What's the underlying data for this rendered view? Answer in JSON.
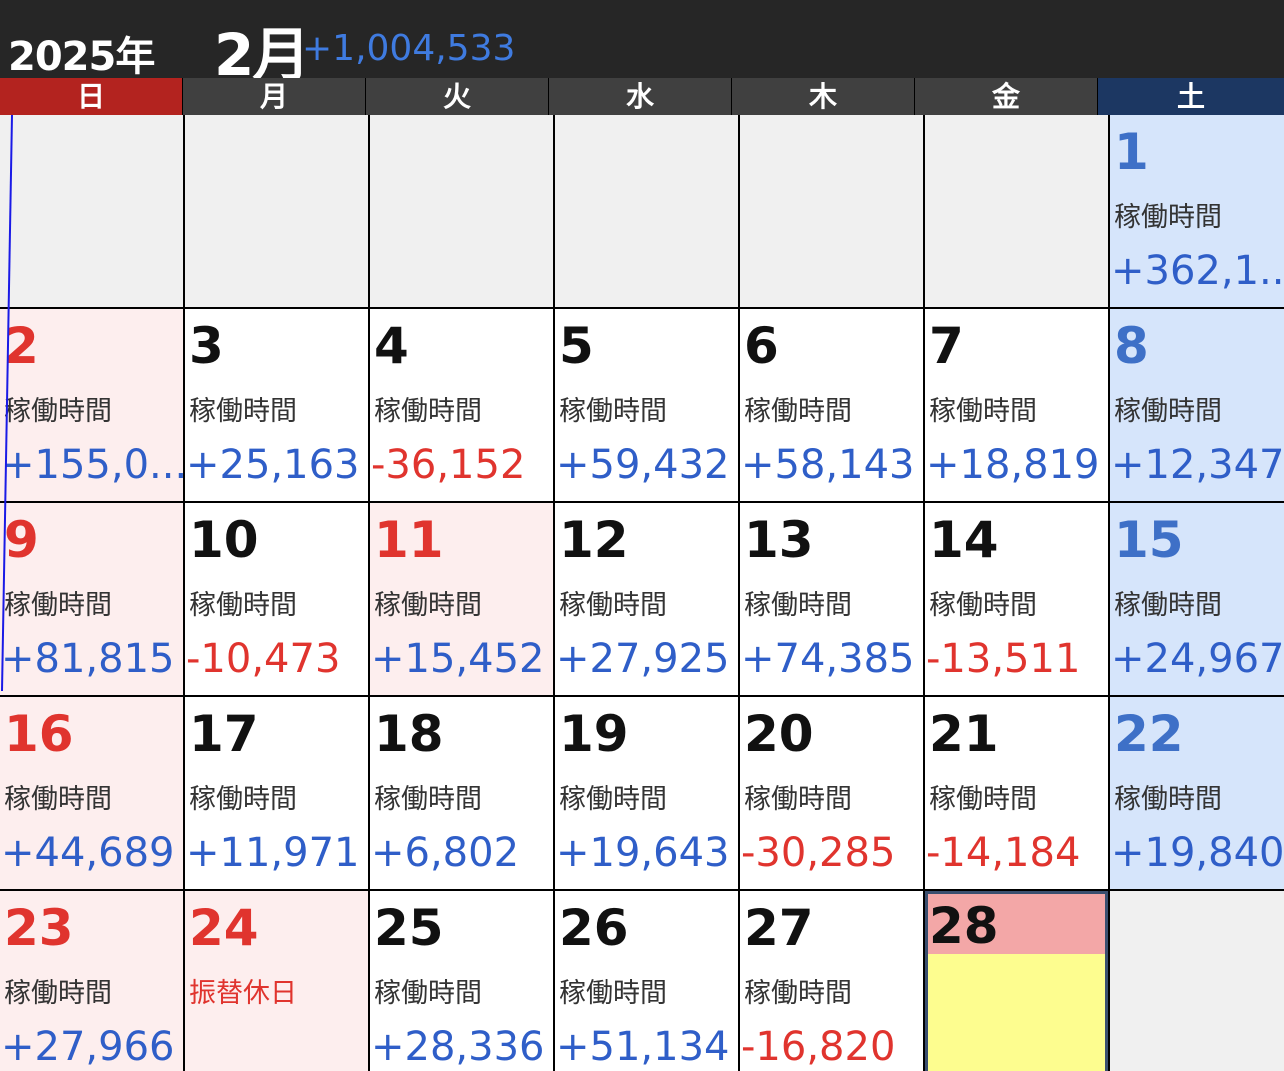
{
  "header": {
    "year": "2025年",
    "month": "2月",
    "total": "+1,004,533"
  },
  "weekdays": [
    "日",
    "月",
    "火",
    "水",
    "木",
    "金",
    "土"
  ],
  "colors": {
    "positive": "#2f5ec8",
    "negative": "#e0342e",
    "sunday": "#b3231f",
    "saturday": "#1c3762"
  },
  "cells": [
    {
      "type": "empty"
    },
    {
      "type": "empty"
    },
    {
      "type": "empty"
    },
    {
      "type": "empty"
    },
    {
      "type": "empty"
    },
    {
      "type": "empty"
    },
    {
      "type": "sat",
      "day": "1",
      "label": "稼働時間",
      "value": "+362,1...",
      "sign": "pos"
    },
    {
      "type": "sun",
      "day": "2",
      "label": "稼働時間",
      "value": "+155,0...",
      "sign": "pos"
    },
    {
      "type": "wk",
      "day": "3",
      "label": "稼働時間",
      "value": "+25,163",
      "sign": "pos"
    },
    {
      "type": "wk",
      "day": "4",
      "label": "稼働時間",
      "value": "-36,152",
      "sign": "neg"
    },
    {
      "type": "wk",
      "day": "5",
      "label": "稼働時間",
      "value": "+59,432",
      "sign": "pos"
    },
    {
      "type": "wk",
      "day": "6",
      "label": "稼働時間",
      "value": "+58,143",
      "sign": "pos"
    },
    {
      "type": "wk",
      "day": "7",
      "label": "稼働時間",
      "value": "+18,819",
      "sign": "pos"
    },
    {
      "type": "sat",
      "day": "8",
      "label": "稼働時間",
      "value": "+12,347",
      "sign": "pos"
    },
    {
      "type": "sun",
      "day": "9",
      "label": "稼働時間",
      "value": "+81,815",
      "sign": "pos"
    },
    {
      "type": "wk",
      "day": "10",
      "label": "稼働時間",
      "value": "-10,473",
      "sign": "neg"
    },
    {
      "type": "hol",
      "day": "11",
      "label": "稼働時間",
      "value": "+15,452",
      "sign": "pos"
    },
    {
      "type": "wk",
      "day": "12",
      "label": "稼働時間",
      "value": "+27,925",
      "sign": "pos"
    },
    {
      "type": "wk",
      "day": "13",
      "label": "稼働時間",
      "value": "+74,385",
      "sign": "pos"
    },
    {
      "type": "wk",
      "day": "14",
      "label": "稼働時間",
      "value": "-13,511",
      "sign": "neg"
    },
    {
      "type": "sat",
      "day": "15",
      "label": "稼働時間",
      "value": "+24,967",
      "sign": "pos"
    },
    {
      "type": "sun",
      "day": "16",
      "label": "稼働時間",
      "value": "+44,689",
      "sign": "pos"
    },
    {
      "type": "wk",
      "day": "17",
      "label": "稼働時間",
      "value": "+11,971",
      "sign": "pos"
    },
    {
      "type": "wk",
      "day": "18",
      "label": "稼働時間",
      "value": "+6,802",
      "sign": "pos"
    },
    {
      "type": "wk",
      "day": "19",
      "label": "稼働時間",
      "value": "+19,643",
      "sign": "pos"
    },
    {
      "type": "wk",
      "day": "20",
      "label": "稼働時間",
      "value": "-30,285",
      "sign": "neg"
    },
    {
      "type": "wk",
      "day": "21",
      "label": "稼働時間",
      "value": "-14,184",
      "sign": "neg"
    },
    {
      "type": "sat",
      "day": "22",
      "label": "稼働時間",
      "value": "+19,840",
      "sign": "pos"
    },
    {
      "type": "sun",
      "day": "23",
      "label": "稼働時間",
      "value": "+27,966",
      "sign": "pos"
    },
    {
      "type": "hol",
      "day": "24",
      "label": "振替休日",
      "value": "",
      "sign": "",
      "label_red": true
    },
    {
      "type": "wk",
      "day": "25",
      "label": "稼働時間",
      "value": "+28,336",
      "sign": "pos"
    },
    {
      "type": "wk",
      "day": "26",
      "label": "稼働時間",
      "value": "+51,134",
      "sign": "pos"
    },
    {
      "type": "wk",
      "day": "27",
      "label": "稼働時間",
      "value": "-16,820",
      "sign": "neg"
    },
    {
      "type": "today",
      "day": "28",
      "label": "",
      "value": "",
      "sign": ""
    },
    {
      "type": "empty"
    }
  ]
}
